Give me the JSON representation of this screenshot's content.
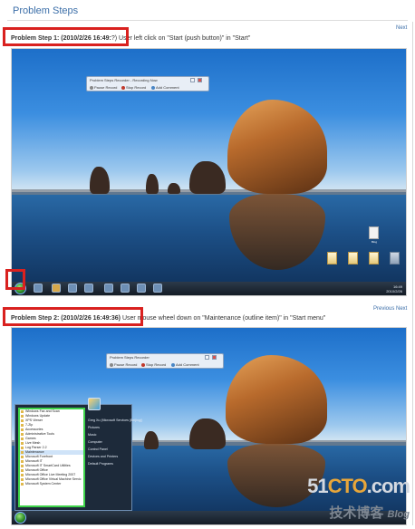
{
  "page": {
    "title": "Problem Steps"
  },
  "step1": {
    "heading": "Problem Step 1: (2010/2/26 16:49:",
    "heading_rest": "?)  User left click on \"Start (push button)\" in \"Start\"",
    "nav_next": "Next"
  },
  "step2": {
    "heading": "Problem Step 2: (2010/2/26 16:49:36)",
    "heading_rest": "  User mouse wheel down on \"Maintenance (outline item)\" in \"Start menu\"",
    "nav_previous": "Previous",
    "nav_next": "Next"
  },
  "recorder1": {
    "title": "Problem Steps Recorder - Recording Now",
    "pause": "Pause Record",
    "stop": "Stop Record",
    "comment": "Add Comment"
  },
  "recorder2": {
    "title": "Problem Steps Recorder",
    "pause": "Pause Record",
    "stop": "Stop Record",
    "comment": "Add Comment"
  },
  "desktop": {
    "icon_top": "Blog",
    "icons": [
      "",
      "",
      "",
      ""
    ],
    "clock_time": "16:49",
    "clock_date": "2010/2/26"
  },
  "start_menu": {
    "left_items": [
      "Windows Fax and Scan",
      "Windows Update",
      "XPS Viewer",
      "7-Zip",
      "Accessories",
      "Administrative Tools",
      "Games",
      "Live Mesh",
      "Log Parser 2.2",
      "Maintenance",
      "Microsoft Forefront",
      "Microsoft IT",
      "Microsoft IT SmartCard Utilities",
      "Microsoft Office",
      "Microsoft Office Live Meeting 2007",
      "Microsoft Office Virtual Machine Servic",
      "Microsoft System Center"
    ],
    "selected_index": 9,
    "right_items": [
      "Greg Xu (Microsoft Services (Beijing))",
      "Pictures",
      "Music",
      "Computer",
      "Control Panel",
      "Devices and Printers",
      "Default Programs"
    ]
  },
  "watermark": {
    "main_prefix": "51",
    "main_accent": "CTO",
    "main_suffix": ".com",
    "sub": "技术博客",
    "blog": "Blog"
  },
  "colors": {
    "link": "#3b6ea8",
    "highlight_box": "#d9211f",
    "selection_outline": "#3fd44a"
  }
}
